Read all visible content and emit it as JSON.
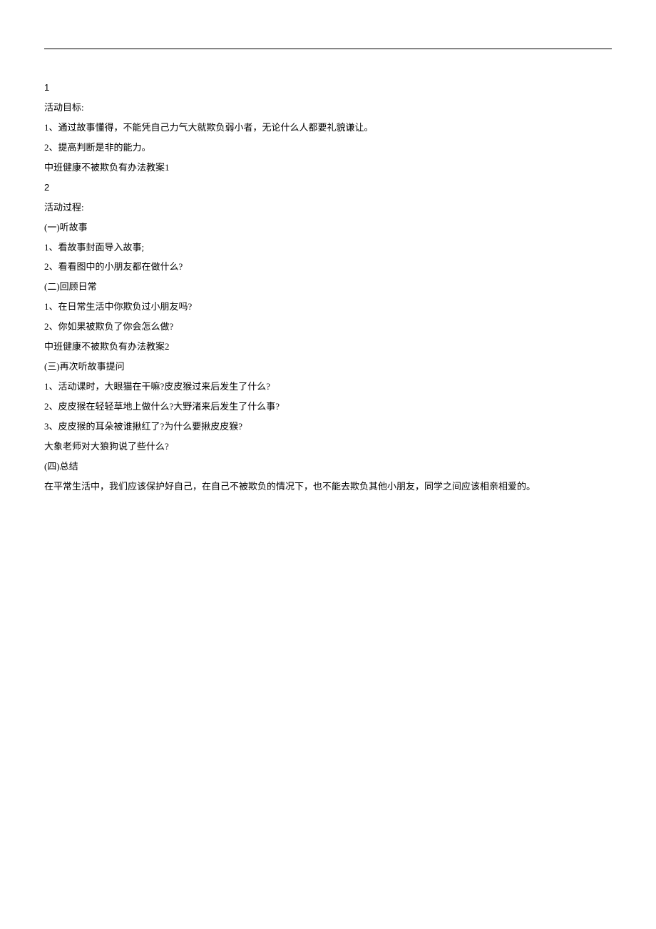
{
  "sections": {
    "num1": "1",
    "goals_title": "活动目标:",
    "goal1": "1、通过故事懂得，不能凭自己力气大就欺负弱小者，无论什么人都要礼貌谦让。",
    "goal2": "2、提高判断是非的能力。",
    "plan1": "中班健康不被欺负有办法教案1",
    "num2": "2",
    "process_title": "活动过程:",
    "part1_title": "(一)听故事",
    "part1_item1": "1、看故事封面导入故事;",
    "part1_item2": "2、看看图中的小朋友都在做什么?",
    "part2_title": "(二)回顾日常",
    "part2_item1": "1、在日常生活中你欺负过小朋友吗?",
    "part2_item2": "2、你如果被欺负了你会怎么做?",
    "plan2": "中班健康不被欺负有办法教案2",
    "part3_title": "(三)再次听故事提问",
    "part3_item1": "1、活动课时，大眼猫在干嘛?皮皮猴过来后发生了什么?",
    "part3_item2": "2、皮皮猴在轻轻草地上做什么?大野渚来后发生了什么事?",
    "part3_item3": "3、皮皮猴的耳朵被谁揪红了?为什么要揪皮皮猴?",
    "part3_q": "大象老师对大狼狗说了些什么?",
    "part4_title": "(四)总结",
    "part4_text": "在平常生活中，我们应该保护好自己，在自己不被欺负的情况下，也不能去欺负其他小朋友，同学之间应该相亲相爱的。"
  }
}
